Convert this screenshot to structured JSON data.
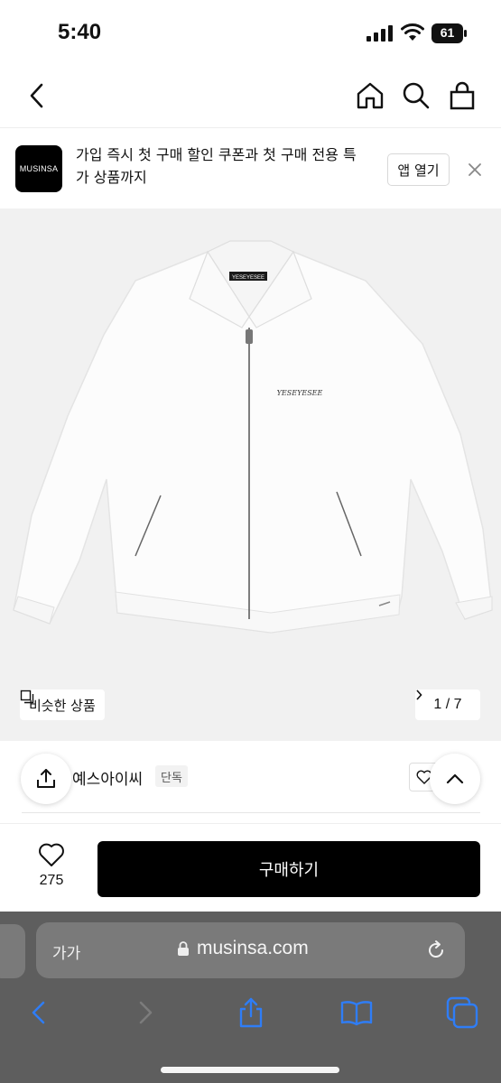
{
  "status_bar": {
    "time": "5:40",
    "battery": "61"
  },
  "nav": {
    "icons": [
      "back-icon",
      "home-icon",
      "search-icon",
      "bag-icon"
    ]
  },
  "promo": {
    "logo_text": "MUSINSA",
    "message": "가입 즉시 첫 구매 할인 쿠폰과 첫 구매 전용 특가 상품까지",
    "open_app_label": "앱 열기"
  },
  "product_image": {
    "similar_label": "비슷한 상품",
    "page_indicator": "1 / 7",
    "collar_label": "YESEYESEE",
    "embroidery_text": "YESEYESEE"
  },
  "brand": {
    "name": "예스아이씨",
    "badge": "단독"
  },
  "buy_bar": {
    "like_count": "275",
    "buy_label": "구매하기"
  },
  "safari": {
    "aa_label": "가가",
    "url": "musinsa.com"
  }
}
